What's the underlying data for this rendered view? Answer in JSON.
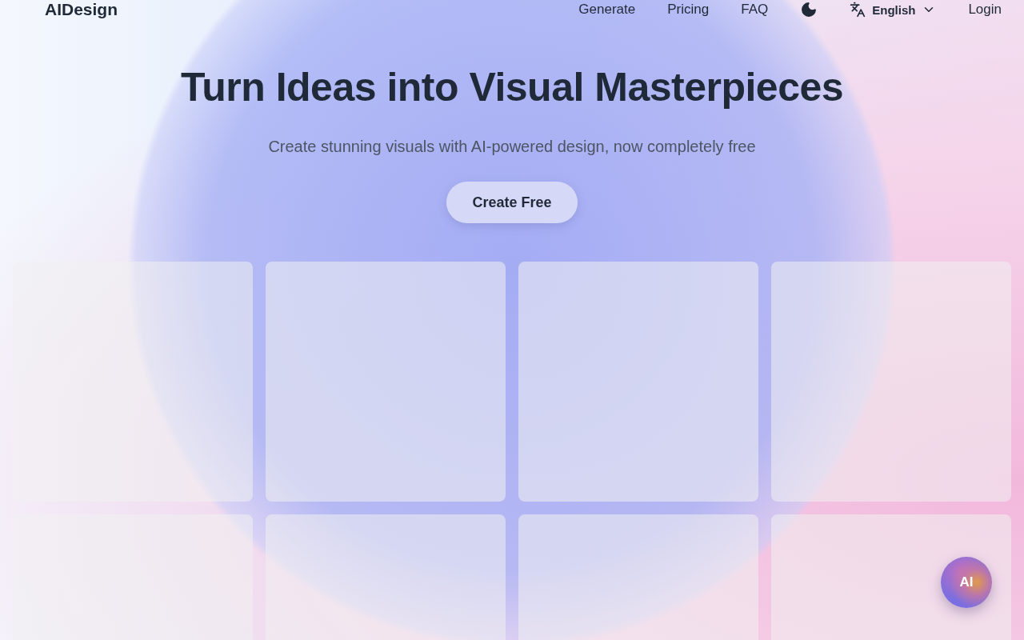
{
  "header": {
    "logo": "AIDesign",
    "nav": [
      {
        "label": "Generate"
      },
      {
        "label": "Pricing"
      },
      {
        "label": "FAQ"
      }
    ],
    "language": "English",
    "login": "Login"
  },
  "hero": {
    "title": "Turn Ideas into Visual Masterpieces",
    "subtitle": "Create stunning visuals with AI-powered design, now completely free",
    "cta": "Create Free"
  },
  "gallery": [
    {
      "kind": "placeholder"
    },
    {
      "kind": "placeholder"
    },
    {
      "kind": "placeholder"
    },
    {
      "kind": "placeholder"
    },
    {
      "kind": "placeholder"
    },
    {
      "kind": "placeholder"
    },
    {
      "kind": "placeholder"
    },
    {
      "kind": "placeholder"
    }
  ],
  "assistant_button": "AI"
}
